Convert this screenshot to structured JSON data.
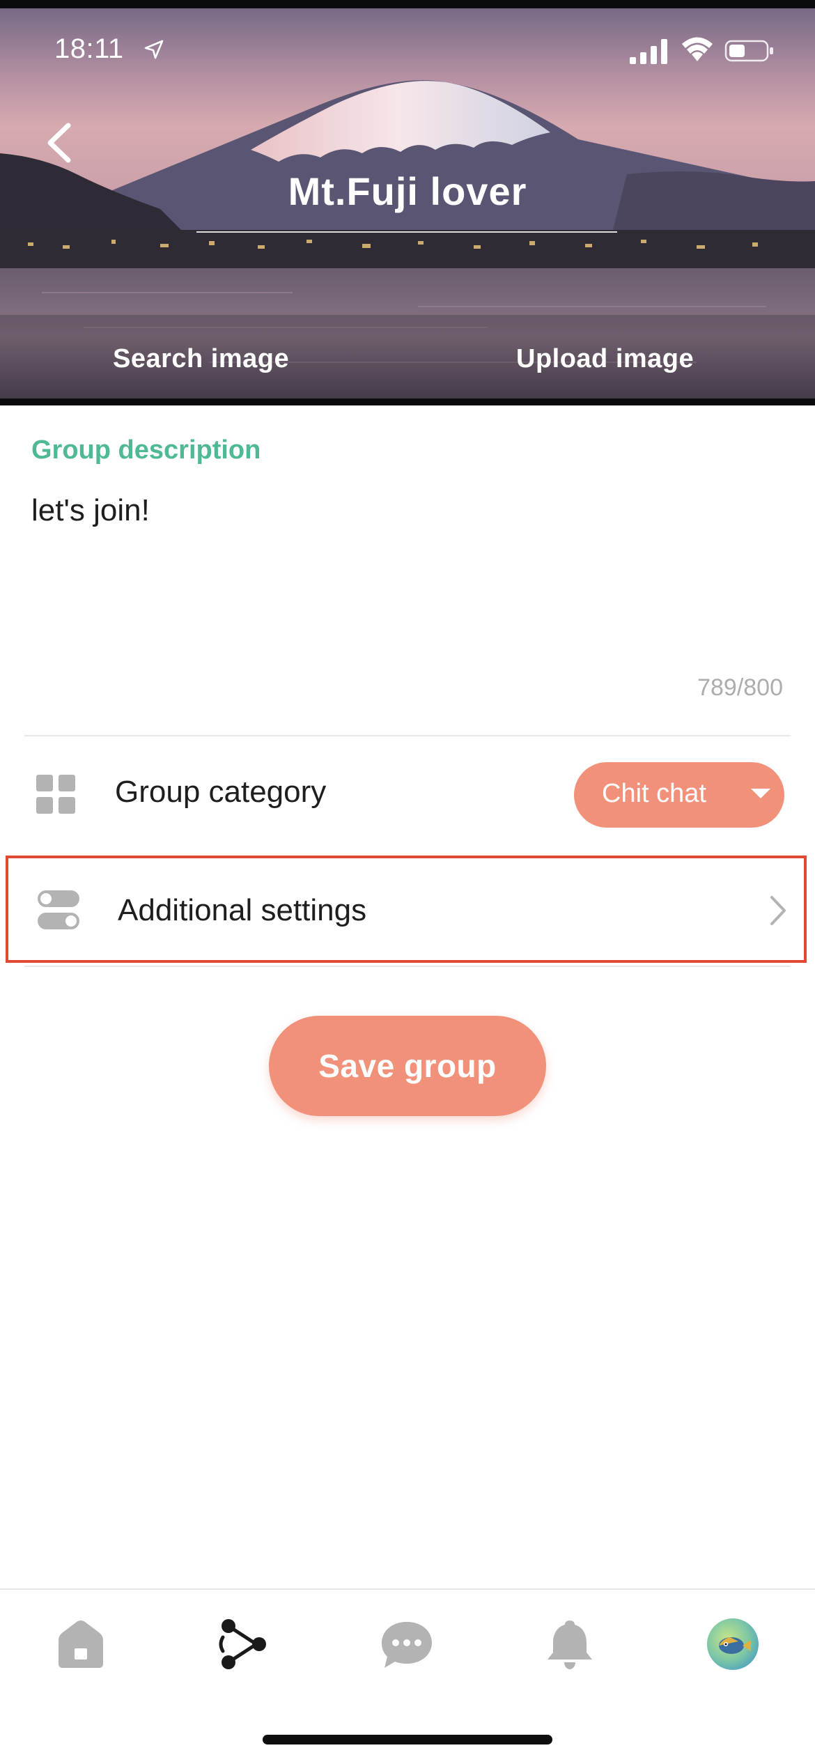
{
  "status_bar": {
    "time": "18:11",
    "icons": [
      "location-arrow-icon",
      "cellular-signal-icon",
      "wifi-icon",
      "battery-icon"
    ]
  },
  "header": {
    "back_icon": "chevron-left-icon",
    "group_name": "Mt.Fuji lover",
    "search_image_label": "Search image",
    "upload_image_label": "Upload image"
  },
  "description": {
    "label": "Group description",
    "value": "let's join!",
    "char_count": "789/800"
  },
  "category": {
    "icon": "grid-icon",
    "label": "Group category",
    "selected": "Chit chat"
  },
  "additional_settings": {
    "icon": "toggles-icon",
    "label": "Additional settings"
  },
  "save_button": {
    "label": "Save group"
  },
  "tab_bar": {
    "items": [
      "home-icon",
      "groups-icon",
      "chat-icon",
      "bell-icon",
      "profile-avatar"
    ]
  },
  "colors": {
    "accent": "#f2917a",
    "description_label": "#4fb996",
    "highlight_border": "#e04a34",
    "tab_inactive": "#b3b3b3",
    "tab_active": "#1a1a1a"
  }
}
